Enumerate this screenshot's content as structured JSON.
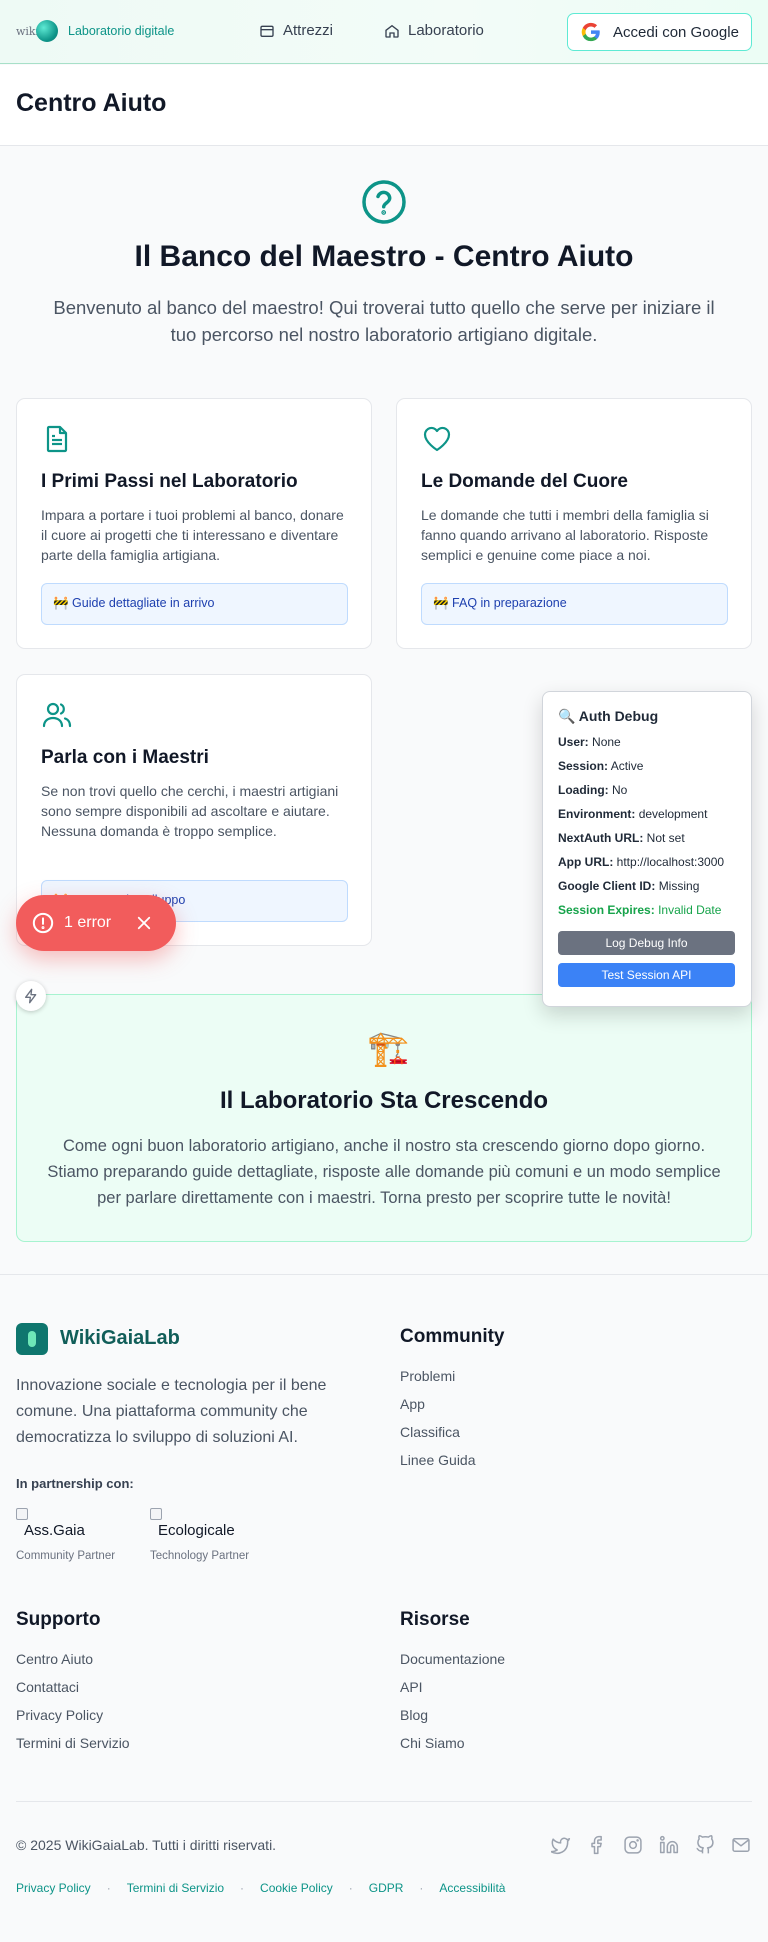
{
  "header": {
    "logo_text": "wiki",
    "brand": "Laboratorio digitale",
    "nav": [
      {
        "label": "Attrezzi",
        "icon": "calendar-icon"
      },
      {
        "label": "Laboratorio",
        "icon": "home-icon"
      }
    ],
    "login_label": "Accedi con Google"
  },
  "page_title": "Centro Aiuto",
  "hero": {
    "title": "Il Banco del Maestro - Centro Aiuto",
    "description": "Benvenuto al banco del maestro! Qui troverai tutto quello che serve per iniziare il tuo percorso nel nostro laboratorio artigiano digitale."
  },
  "cards": [
    {
      "icon": "document-icon",
      "title": "I Primi Passi nel Laboratorio",
      "text": "Impara a portare i tuoi problemi al banco, donare il cuore ai progetti che ti interessano e diventare parte della famiglia artigiana.",
      "note": "🚧 Guide dettagliate in arrivo"
    },
    {
      "icon": "heart-icon",
      "title": "Le Domande del Cuore",
      "text": "Le domande che tutti i membri della famiglia si fanno quando arrivano al laboratorio. Risposte semplici e genuine come piace a noi.",
      "note": "🚧 FAQ in preparazione"
    },
    {
      "icon": "users-icon",
      "title": "Parla con i Maestri",
      "text": "Se non trovi quello che cerchi, i maestri artigiani sono sempre disponibili ad ascoltare e aiutare. Nessuna domanda è troppo semplice.",
      "note": "🚧 Supporto in sviluppo"
    }
  ],
  "debug": {
    "title": "🔍 Auth Debug",
    "rows": [
      {
        "key": "User:",
        "value": "None"
      },
      {
        "key": "Session:",
        "value": "Active"
      },
      {
        "key": "Loading:",
        "value": "No"
      },
      {
        "key": "Environment:",
        "value": "development"
      },
      {
        "key": "NextAuth URL:",
        "value": "Not set"
      },
      {
        "key": "App URL:",
        "value": "http://localhost:3000"
      },
      {
        "key": "Google Client ID:",
        "value": "Missing"
      },
      {
        "key": "Session Expires:",
        "value": "Invalid Date"
      }
    ],
    "log_button": "Log Debug Info",
    "test_button": "Test Session API"
  },
  "error_badge": {
    "label": "1 error"
  },
  "growing": {
    "emoji": "🏗️",
    "title": "Il Laboratorio Sta Crescendo",
    "text": "Come ogni buon laboratorio artigiano, anche il nostro sta crescendo giorno dopo giorno. Stiamo preparando guide dettagliate, risposte alle domande più comuni e un modo semplice per parlare direttamente con i maestri. Torna presto per scoprire tutte le novità!"
  },
  "footer": {
    "brand": "WikiGaiaLab",
    "description": "Innovazione sociale e tecnologia per il bene comune. Una piattaforma community che democratizza lo sviluppo di soluzioni AI.",
    "partnership_label": "In partnership con:",
    "partners": [
      {
        "alt": "Ass.Gaia",
        "label": "Community Partner"
      },
      {
        "alt": "Ecologicale",
        "label": "Technology Partner"
      }
    ],
    "community": {
      "title": "Community",
      "links": [
        "Problemi",
        "App",
        "Classifica",
        "Linee Guida"
      ]
    },
    "supporto": {
      "title": "Supporto",
      "links": [
        "Centro Aiuto",
        "Contattaci",
        "Privacy Policy",
        "Termini di Servizio"
      ]
    },
    "risorse": {
      "title": "Risorse",
      "links": [
        "Documentazione",
        "API",
        "Blog",
        "Chi Siamo"
      ]
    },
    "copyright": "© 2025 WikiGaiaLab. Tutti i diritti riservati.",
    "socials": [
      "twitter-icon",
      "facebook-icon",
      "instagram-icon",
      "linkedin-icon",
      "github-icon",
      "mail-icon"
    ],
    "legal": [
      "Privacy Policy",
      "Termini di Servizio",
      "Cookie Policy",
      "GDPR",
      "Accessibilità"
    ]
  },
  "colors": {
    "brand": "#0d9488",
    "error": "#f25c5c",
    "debug_blue": "#3b82f6",
    "debug_gray": "#6b7280",
    "success": "#16a34a"
  }
}
